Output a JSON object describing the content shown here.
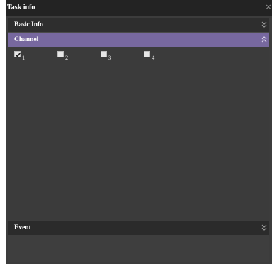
{
  "window": {
    "title": "Task info",
    "close_glyph": "×"
  },
  "sections": {
    "basic_info": {
      "label": "Basic Info",
      "state": "collapsed"
    },
    "channel": {
      "label": "Channel",
      "state": "expanded"
    },
    "event": {
      "label": "Event",
      "state": "collapsed"
    }
  },
  "channels": [
    {
      "label": "1",
      "checked": true
    },
    {
      "label": "2",
      "checked": false
    },
    {
      "label": "3",
      "checked": false
    },
    {
      "label": "4",
      "checked": false
    }
  ],
  "colors": {
    "panel_bg": "#3c3c3c",
    "titlebar_bg": "#232323",
    "active_header": "#77689f",
    "text": "#ffffff"
  }
}
